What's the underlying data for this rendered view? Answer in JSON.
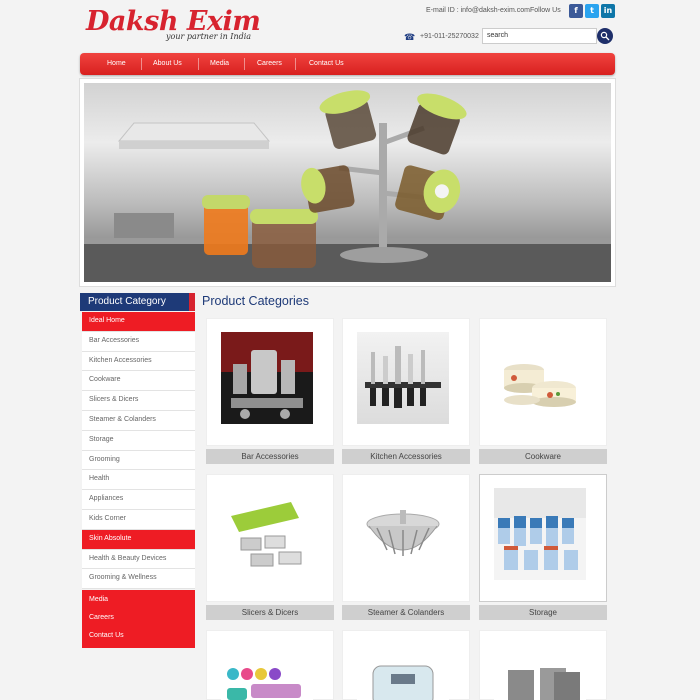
{
  "header": {
    "logo": "Daksh Exim",
    "tagline": "your partner in India",
    "email": "E-mail ID : info@daksh-exim.com",
    "follow": "Follow Us",
    "social": [
      "f",
      "t",
      "in"
    ],
    "phone": "+91-011-25270032",
    "search_value": "search"
  },
  "nav": [
    "Home",
    "About Us",
    "Media",
    "Careers",
    "Contact Us"
  ],
  "sidebar": {
    "heading": "Product Category",
    "items": [
      "Ideal Home",
      "Bar Accessories",
      "Kitchen Accessories",
      "Cookware",
      "Slicers & Dicers",
      "Steamer & Colanders",
      "Storage",
      "Grooming",
      "Health",
      "Appliances",
      "Kids Corner",
      "Skin Absolute",
      "Health & Beauty Devices",
      "Grooming & Wellness"
    ],
    "bottom_items": [
      "Media",
      "Careers",
      "Contact Us"
    ]
  },
  "main": {
    "title": "Product Categories",
    "cards": [
      "Bar Accessories",
      "Kitchen Accessories",
      "Cookware",
      "Slicers & Dicers",
      "Steamer & Colanders",
      "Storage"
    ]
  },
  "colors": {
    "brand_red": "#d7232f",
    "nav_red": "#e3302d",
    "navy": "#1e3a78"
  }
}
